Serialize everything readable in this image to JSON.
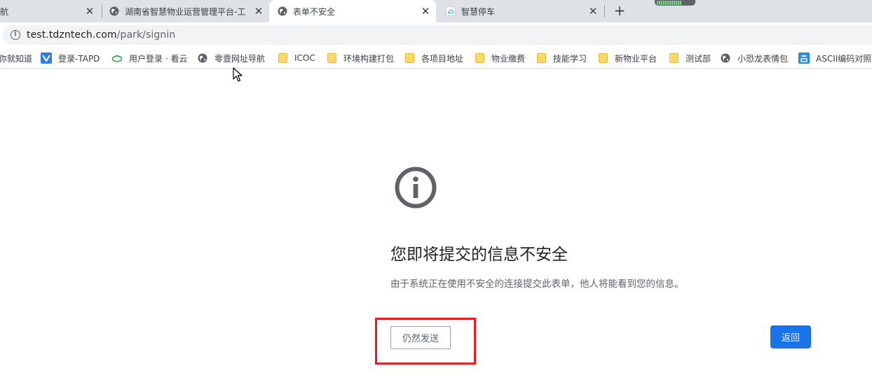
{
  "tabs": [
    {
      "title": "航",
      "active": false
    },
    {
      "title": "湖南省智慧物业运营管理平台-工",
      "active": false,
      "favicon": "globe-icon"
    },
    {
      "title": "表单不安全",
      "active": true,
      "favicon": "globe-icon"
    },
    {
      "title": "智慧停车",
      "active": false,
      "favicon": "cloud-icon"
    }
  ],
  "tab_close_glyph": "✕",
  "new_tab_glyph": "+",
  "address_bar": {
    "host": "test.tdzntech.com",
    "path": "/park/signin"
  },
  "bookmarks": [
    {
      "label": "你就知道",
      "icon": "none"
    },
    {
      "label": "登录-TAPD",
      "icon": "tapd-icon"
    },
    {
      "label": "用户登录 · 看云",
      "icon": "kancloud-icon"
    },
    {
      "label": "零壹网址导航",
      "icon": "globe-icon"
    },
    {
      "label": "ICOC",
      "icon": "folder-icon"
    },
    {
      "label": "环境构建打包",
      "icon": "folder-icon"
    },
    {
      "label": "各项目地址",
      "icon": "folder-icon"
    },
    {
      "label": "物业缴费",
      "icon": "folder-icon"
    },
    {
      "label": "技能学习",
      "icon": "folder-icon"
    },
    {
      "label": "新物业平台",
      "icon": "folder-icon"
    },
    {
      "label": "测试部",
      "icon": "folder-icon"
    },
    {
      "label": "小恐龙表情包",
      "icon": "globe-icon"
    },
    {
      "label": "ASCII编码对照",
      "icon": "ascii-icon"
    }
  ],
  "interstitial": {
    "icon": "info-icon",
    "heading": "您即将提交的信息不安全",
    "description": "由于系统正在使用不安全的连接提交此表单，他人将能看到您的信息。",
    "send_anyway_label": "仍然发送",
    "go_back_label": "返回"
  },
  "colors": {
    "accent": "#1a73e8",
    "highlight": "#e81c1c"
  }
}
